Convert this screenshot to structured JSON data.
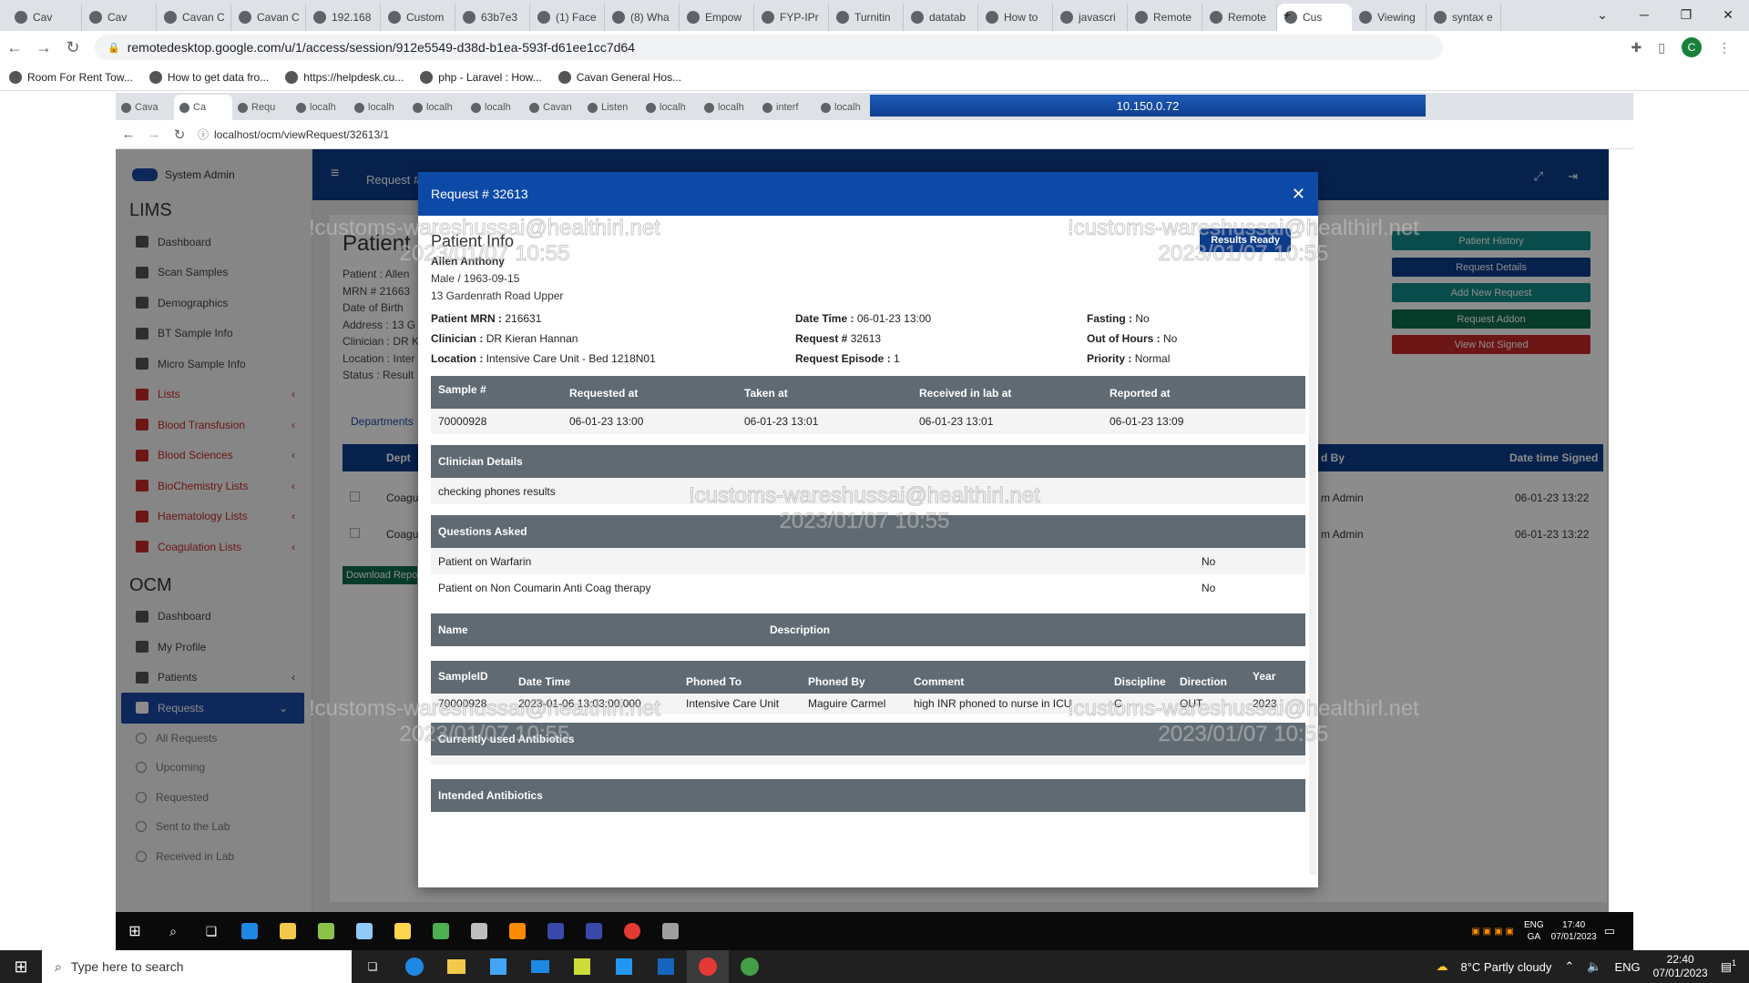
{
  "outer_browser": {
    "tabs": [
      "Cav",
      "Cav",
      "Cavan C",
      "Cavan C",
      "192.168",
      "Custom",
      "63b7e3",
      "(1) Face",
      "(8) Wha",
      "Empow",
      "FYP-IPr",
      "Turnitin",
      "datatab",
      "How to",
      "javascri",
      "Remote",
      "Remote",
      "Cus",
      "Viewing",
      "syntax e"
    ],
    "url": "remotedesktop.google.com/u/1/access/session/912e5549-d38d-b1ea-593f-d61ee1cc7d64",
    "bookmarks": [
      "Room For Rent Tow...",
      "How to get data fro...",
      "https://helpdesk.cu...",
      "php - Laravel : How...",
      "Cavan General Hos..."
    ],
    "profile": "C"
  },
  "remote_bar": {
    "ip": "10.150.0.72"
  },
  "inner_browser": {
    "tabs": [
      "Cava",
      "Ca",
      "Requ",
      "localh",
      "localh",
      "localh",
      "localh",
      "Cavan",
      "Listen",
      "localh",
      "localh",
      "interf",
      "localh"
    ],
    "url": "localhost/ocm/viewRequest/32613/1"
  },
  "sidebar": {
    "user": "System Admin",
    "lims_title": "LIMS",
    "lims_items": [
      {
        "label": "Dashboard",
        "red": false
      },
      {
        "label": "Scan Samples",
        "red": false
      },
      {
        "label": "Demographics",
        "red": false
      },
      {
        "label": "BT Sample Info",
        "red": false
      },
      {
        "label": "Micro Sample Info",
        "red": false
      },
      {
        "label": "Lists",
        "red": true
      },
      {
        "label": "Blood Transfusion",
        "red": true
      },
      {
        "label": "Blood Sciences",
        "red": true
      },
      {
        "label": "BioChemistry Lists",
        "red": true
      },
      {
        "label": "Haematology Lists",
        "red": true
      },
      {
        "label": "Coagulation Lists",
        "red": true
      }
    ],
    "ocm_title": "OCM",
    "ocm_items": [
      "Dashboard",
      "My Profile",
      "Patients",
      "Requests"
    ],
    "request_sub": [
      "All Requests",
      "Upcoming",
      "Requested",
      "Sent to the Lab",
      "Received in Lab"
    ]
  },
  "background_page": {
    "topbar_title": "Request #",
    "page_title": "Patient",
    "patient_lines": [
      "Patient : Allen",
      "MRN # 21663",
      "Date of Birth",
      "Address : 13 G",
      "Clinician : DR K",
      "Location : Inter",
      "Status : Result"
    ],
    "tab_label": "Departments",
    "table_headers": {
      "dept": "Dept",
      "signed_by": "d By",
      "date_signed": "Date time Signed"
    },
    "rows": [
      {
        "dept": "Coagu",
        "signed_by": "m Admin",
        "date": "06-01-23 13:22"
      },
      {
        "dept": "Coagu",
        "signed_by": "m Admin",
        "date": "06-01-23 13:22"
      }
    ],
    "download_btn": "Download Repo",
    "right_buttons": [
      {
        "label": "Patient History",
        "color": "#138a8a"
      },
      {
        "label": "Request Details",
        "color": "#0d3c8d"
      },
      {
        "label": "Add New Request",
        "color": "#138a8a"
      },
      {
        "label": "Request Addon",
        "color": "#0f6e4e"
      },
      {
        "label": "View Not Signed",
        "color": "#c62828"
      }
    ]
  },
  "modal": {
    "title": "Request # 32613",
    "section_title": "Patient Info",
    "results_ready": "Results Ready",
    "patient_name": "Allen Anthony",
    "sex_dob": "Male / 1963-09-15",
    "address": "13 Gardenrath Road Upper",
    "info_grid": [
      {
        "label": "Patient MRN :",
        "value": "216631"
      },
      {
        "label": "Date Time :",
        "value": "06-01-23 13:00"
      },
      {
        "label": "Fasting :",
        "value": "No"
      },
      {
        "label": "Clinician :",
        "value": "DR Kieran Hannan"
      },
      {
        "label": "Request # ",
        "value": "32613"
      },
      {
        "label": "Out of Hours :",
        "value": "No"
      },
      {
        "label": "Location :",
        "value": "Intensive Care Unit - Bed 1218N01"
      },
      {
        "label": "Request Episode :",
        "value": "1"
      },
      {
        "label": "Priority :",
        "value": "Normal"
      }
    ],
    "samples": {
      "headers": [
        "Sample #",
        "Requested at",
        "Taken at",
        "Received in lab at",
        "Reported at"
      ],
      "row": [
        "70000928",
        "06-01-23 13:00",
        "06-01-23 13:01",
        "06-01-23 13:01",
        "06-01-23 13:09"
      ]
    },
    "clinician_details": {
      "header": "Clinician Details",
      "text": "checking phones results"
    },
    "questions": {
      "header": "Questions Asked",
      "items": [
        {
          "q": "Patient on Warfarin",
          "a": "No"
        },
        {
          "q": "Patient on Non Coumarin Anti Coag therapy",
          "a": "No"
        }
      ]
    },
    "name_desc": {
      "name": "Name",
      "description": "Description"
    },
    "phone_log": {
      "headers": [
        "SampleID",
        "Date Time",
        "Phoned To",
        "Phoned By",
        "Comment",
        "Discipline",
        "Direction",
        "Year"
      ],
      "row": [
        "70000928",
        "2023-01-06 13:03:00.000",
        "Intensive Care Unit",
        "Maguire Carmel",
        "high INR phoned to nurse in ICU",
        "C",
        "OUT",
        "2023"
      ]
    },
    "antibiotics_current": "Currently used Antibiotics",
    "antibiotics_intended": "Intended Antibiotics",
    "watermark_email": "!customs-wareshussai@healthirl.net",
    "watermark_date": "2023/01/07 10:55"
  },
  "vm_taskbar": {
    "lang": "ENG",
    "lang2": "GA",
    "time": "17:40",
    "date": "07/01/2023"
  },
  "host_taskbar": {
    "search_placeholder": "Type here to search",
    "weather": "8°C  Partly cloudy",
    "lang": "ENG",
    "time": "22:40",
    "date": "07/01/2023",
    "notif": "1"
  }
}
